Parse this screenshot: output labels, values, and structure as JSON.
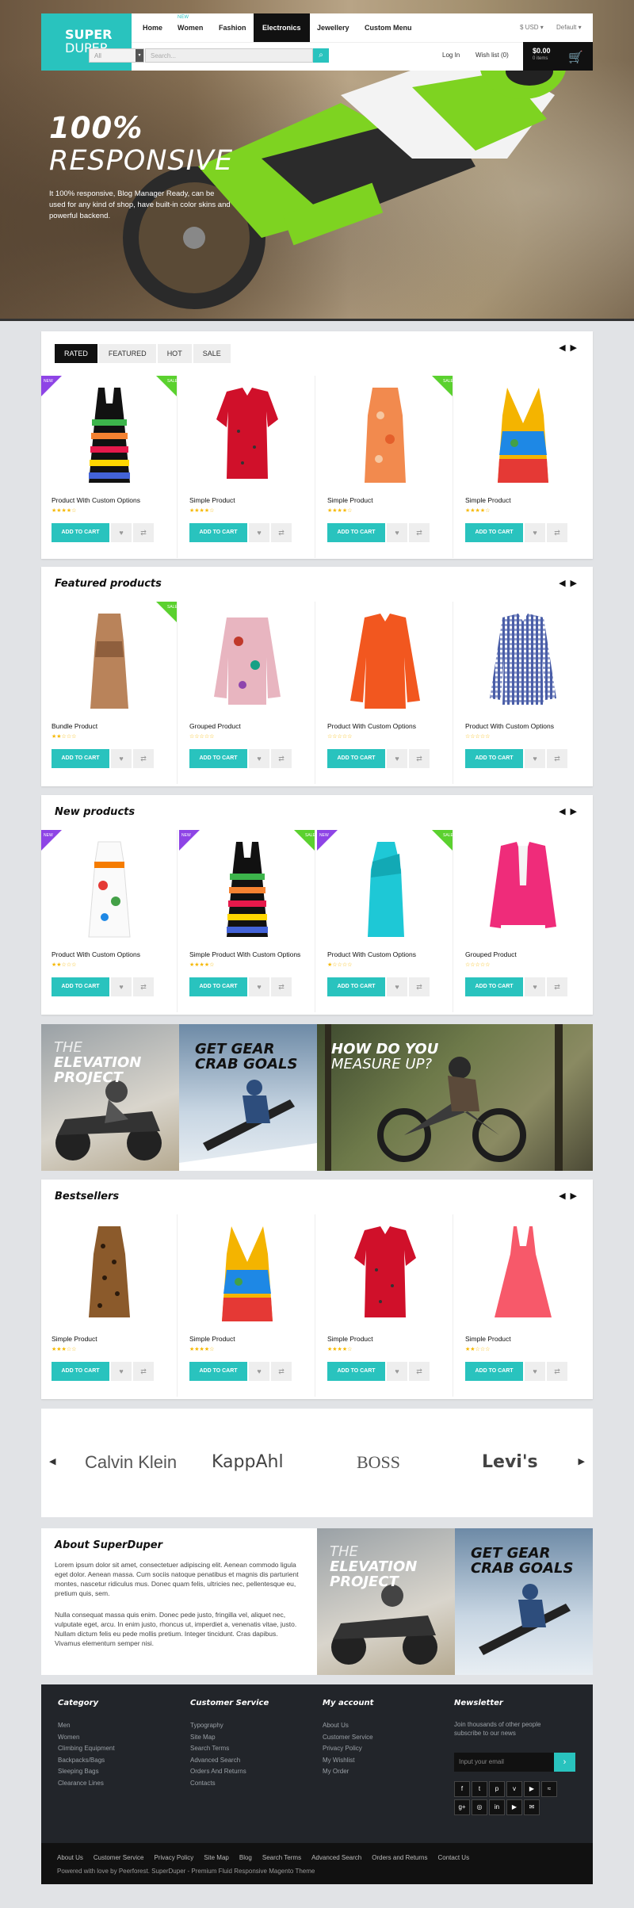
{
  "header": {
    "logo_line1": "SUPER",
    "logo_line2": "DUPER",
    "nav": [
      {
        "label": "Home"
      },
      {
        "label": "Women",
        "tag": "NEW"
      },
      {
        "label": "Fashion"
      },
      {
        "label": "Electronics"
      },
      {
        "label": "Jewellery"
      },
      {
        "label": "Custom Menu"
      }
    ],
    "currency": "$ USD",
    "store": "Default",
    "category_select": "All",
    "search_placeholder": "Search...",
    "login": "Log In",
    "wishlist": "Wish list (0)",
    "cart_total": "$0.00",
    "cart_items": "0 items"
  },
  "hero": {
    "title": "100%",
    "subtitle": "RESPONSIVE",
    "text": "It 100% responsive, Blog Manager Ready, can be used for any kind of shop, have built-in color skins and powerful backend."
  },
  "tabs_panel": {
    "tabs": [
      "RATED",
      "FEATURED",
      "HOT",
      "SALE"
    ],
    "products": [
      {
        "name": "Product With Custom Options",
        "stars": "★★★★☆",
        "new": true,
        "sale": true
      },
      {
        "name": "Simple Product",
        "stars": "★★★★☆",
        "new": false,
        "sale": false
      },
      {
        "name": "Simple Product",
        "stars": "★★★★☆",
        "new": false,
        "sale": true
      },
      {
        "name": "Simple Product",
        "stars": "★★★★☆",
        "new": false,
        "sale": false
      }
    ]
  },
  "featured": {
    "title": "Featured products",
    "products": [
      {
        "name": "Bundle Product",
        "stars": "★★☆☆☆"
      },
      {
        "name": "Grouped Product",
        "stars": "☆☆☆☆☆"
      },
      {
        "name": "Product With Custom Options",
        "stars": "☆☆☆☆☆"
      },
      {
        "name": "Product With Custom Options",
        "stars": "☆☆☆☆☆"
      }
    ]
  },
  "new_products": {
    "title": "New products",
    "products": [
      {
        "name": "Product With Custom Options",
        "stars": "★★☆☆☆"
      },
      {
        "name": "Simple Product With Custom Options",
        "stars": "★★★★☆"
      },
      {
        "name": "Product With Custom Options",
        "stars": "★☆☆☆☆"
      },
      {
        "name": "Grouped Product",
        "stars": "☆☆☆☆☆"
      }
    ]
  },
  "banners": {
    "b1_line1": "THE",
    "b1_line2": "ELEVATION",
    "b1_line3": "PROJECT",
    "b2_line1": "GET GEAR",
    "b2_line2": "CRAB GOALS",
    "b3_line1": "HOW DO YOU",
    "b3_line2": "MEASURE UP?"
  },
  "bestsellers": {
    "title": "Bestsellers",
    "products": [
      {
        "name": "Simple Product",
        "stars": "★★★☆☆"
      },
      {
        "name": "Simple Product",
        "stars": "★★★★☆"
      },
      {
        "name": "Simple Product",
        "stars": "★★★★☆"
      },
      {
        "name": "Simple Product",
        "stars": "★★☆☆☆"
      }
    ]
  },
  "labels": {
    "add_to_cart": "ADD TO CART",
    "wish_icon": "♥",
    "compare_icon": "⇄",
    "new_tag": "NEW",
    "sale_tag": "SALE"
  },
  "brands": [
    "Calvin Klein",
    "KappAhl",
    "BOSS",
    "Levi's"
  ],
  "about": {
    "title": "About SuperDuper",
    "p1": "Lorem ipsum dolor sit amet, consectetuer adipiscing elit. Aenean commodo ligula eget dolor. Aenean massa. Cum sociis natoque penatibus et magnis dis parturient montes, nascetur ridiculus mus. Donec quam felis, ultricies nec, pellentesque eu, pretium quis, sem.",
    "p2": "Nulla consequat massa quis enim. Donec pede justo, fringilla vel, aliquet nec, vulputate eget, arcu. In enim justo, rhoncus ut, imperdiet a, venenatis vitae, justo. Nullam dictum felis eu pede mollis pretium. Integer tincidunt. Cras dapibus. Vivamus elementum semper nisi."
  },
  "footer": {
    "category": {
      "title": "Category",
      "links": [
        "Men",
        "Women",
        "Climbing Equipment",
        "Backpacks/Bags",
        "Sleeping Bags",
        "Clearance Lines"
      ]
    },
    "service": {
      "title": "Customer Service",
      "links": [
        "Typography",
        "Site Map",
        "Search Terms",
        "Advanced Search",
        "Orders And Returns",
        "Contacts"
      ]
    },
    "account": {
      "title": "My account",
      "links": [
        "About Us",
        "Customer Service",
        "Privacy Policy",
        "My Wishlist",
        "My Order"
      ]
    },
    "newsletter": {
      "title": "Newsletter",
      "text": "Join thousands of other people subscribe to our news",
      "placeholder": "Input your email"
    },
    "bottom_links": [
      "About Us",
      "Customer Service",
      "Privacy Policy",
      "Site Map",
      "Blog",
      "Search Terms",
      "Advanced Search",
      "Orders and Returns",
      "Contact Us"
    ],
    "copyright": "Powered with love by Peerforest. SuperDuper - Premium Fluid Responsive Magento Theme"
  },
  "colors": {
    "accent": "#29c3be",
    "dark": "#111111",
    "new_tag": "#8e44e6",
    "sale_tag": "#5bd12f"
  }
}
